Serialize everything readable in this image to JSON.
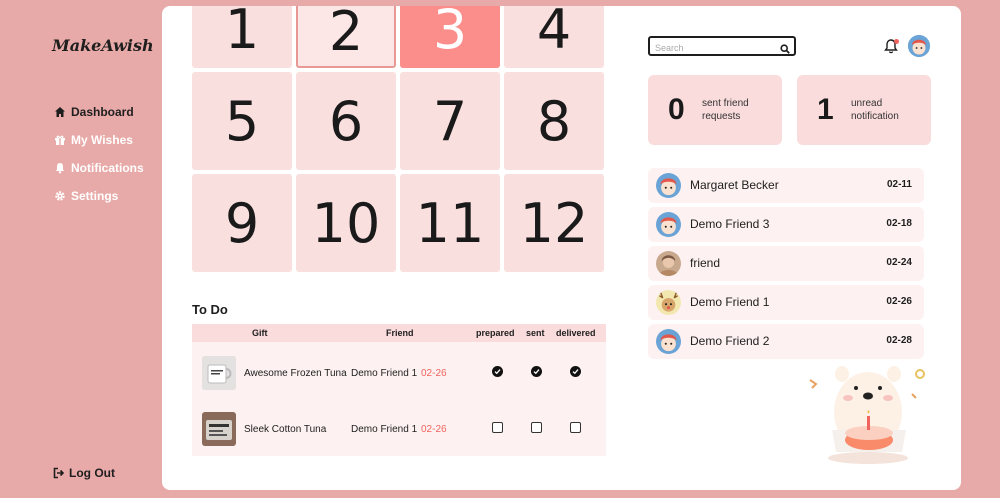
{
  "app": {
    "logo": "MakeAwish"
  },
  "sidebar": {
    "items": [
      {
        "label": "Dashboard",
        "icon": "home-icon",
        "active": true
      },
      {
        "label": "My Wishes",
        "icon": "gift-icon",
        "active": false
      },
      {
        "label": "Notifications",
        "icon": "bell-icon",
        "active": false
      },
      {
        "label": "Settings",
        "icon": "gear-icon",
        "active": false
      }
    ],
    "logout_label": "Log Out"
  },
  "calendar": {
    "days": [
      "1",
      "2",
      "3",
      "4",
      "5",
      "6",
      "7",
      "8",
      "9",
      "10",
      "11",
      "12"
    ],
    "selected": "3",
    "highlighted": "2"
  },
  "todo": {
    "title": "To Do",
    "columns": {
      "gift": "Gift",
      "friend": "Friend",
      "prepared": "prepared",
      "sent": "sent",
      "delivered": "delivered"
    },
    "rows": [
      {
        "gift": "Awesome Frozen Tuna",
        "friend": "Demo Friend 1",
        "date": "02-26",
        "prepared": true,
        "sent": true,
        "delivered": true
      },
      {
        "gift": "Sleek Cotton Tuna",
        "friend": "Demo Friend 1",
        "date": "02-26",
        "prepared": false,
        "sent": false,
        "delivered": false
      }
    ]
  },
  "search": {
    "placeholder": "Search",
    "value": ""
  },
  "stats": {
    "friend_requests": {
      "count": "0",
      "label": "sent friend requests"
    },
    "notifications": {
      "count": "1",
      "label": "unread notification"
    }
  },
  "friends": [
    {
      "name": "Margaret Becker",
      "date": "02-11",
      "avatar": "boy-avatar"
    },
    {
      "name": "Demo Friend 3",
      "date": "02-18",
      "avatar": "boy-avatar"
    },
    {
      "name": "friend",
      "date": "02-24",
      "avatar": "photo-avatar"
    },
    {
      "name": "Demo Friend 1",
      "date": "02-26",
      "avatar": "reindeer-avatar"
    },
    {
      "name": "Demo Friend 2",
      "date": "02-28",
      "avatar": "boy-avatar"
    }
  ],
  "colors": {
    "background": "#e8aaa8",
    "accent": "#fb8d8a",
    "tile": "#fadfdf",
    "date_red": "#f0635e"
  }
}
